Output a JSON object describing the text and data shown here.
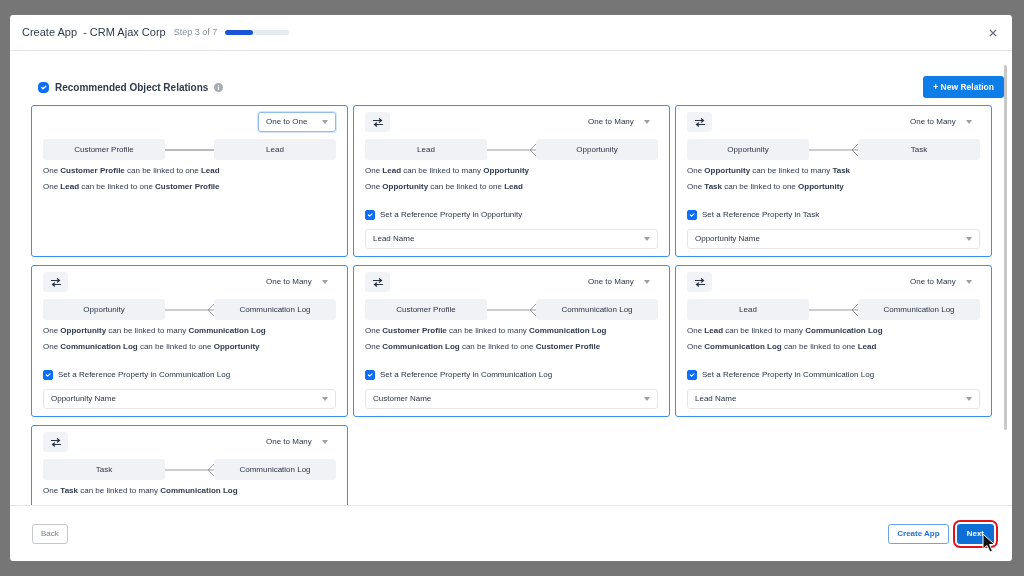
{
  "modal": {
    "title": "Create App  - CRM Ajax Corp",
    "step": "Step 3 of 7",
    "progress": {
      "level": 0.43
    }
  },
  "section": {
    "checked": true,
    "title": "Recommended Object Relations",
    "new_button": "+ New Relation"
  },
  "relations": [
    {
      "swap": false,
      "cardinality": "One to One",
      "focused": true,
      "left": "Customer Profile",
      "right": "Lead",
      "kind": "one-to-one",
      "sentences": [
        "One **Customer Profile** can be linked to one **Lead**",
        "One **Lead** can be linked to one **Customer Profile**"
      ]
    },
    {
      "swap": true,
      "cardinality": "One to Many",
      "focused": false,
      "left": "Lead",
      "right": "Opportunity",
      "kind": "one-to-many",
      "sentences": [
        "One **Lead** can be linked to many **Opportunity**",
        "One **Opportunity** can be linked to one **Lead**"
      ],
      "reference": {
        "checked": true,
        "label": "Set a Reference Property in Opportunity",
        "value": "Lead Name"
      }
    },
    {
      "swap": true,
      "cardinality": "One to Many",
      "focused": false,
      "left": "Opportunity",
      "right": "Task",
      "kind": "one-to-many",
      "sentences": [
        "One **Opportunity** can be linked to many **Task**",
        "One **Task** can be linked to one **Opportunity**"
      ],
      "reference": {
        "checked": true,
        "label": "Set a Reference Property in Task",
        "value": "Opportunity Name"
      }
    },
    {
      "swap": true,
      "cardinality": "One to Many",
      "focused": false,
      "left": "Opportunity",
      "right": "Communication Log",
      "kind": "one-to-many",
      "sentences": [
        "One **Opportunity** can be linked to many **Communication Log**",
        "One **Communication Log** can be linked to one **Opportunity**"
      ],
      "reference": {
        "checked": true,
        "label": "Set a Reference Property in Communication Log",
        "value": "Opportunity Name"
      }
    },
    {
      "swap": true,
      "cardinality": "One to Many",
      "focused": false,
      "left": "Customer Profile",
      "right": "Communication Log",
      "kind": "one-to-many",
      "sentences": [
        "One **Customer Profile** can be linked to many **Communication Log**",
        "One **Communication Log** can be linked to one **Customer Profile**"
      ],
      "reference": {
        "checked": true,
        "label": "Set a Reference Property in Communication Log",
        "value": "Customer Name"
      }
    },
    {
      "swap": true,
      "cardinality": "One to Many",
      "focused": false,
      "left": "Lead",
      "right": "Communication Log",
      "kind": "one-to-many",
      "sentences": [
        "One **Lead** can be linked to many **Communication Log**",
        "One **Communication Log** can be linked to one **Lead**"
      ],
      "reference": {
        "checked": true,
        "label": "Set a Reference Property in Communication Log",
        "value": "Lead Name"
      }
    },
    {
      "swap": true,
      "cardinality": "One to Many",
      "focused": false,
      "left": "Task",
      "right": "Communication Log",
      "kind": "one-to-many",
      "sentences": [
        "One **Task** can be linked to many **Communication Log**"
      ]
    }
  ],
  "footer": {
    "back": "Back",
    "create": "Create App",
    "next": "Next",
    "next_highlighted": true
  }
}
